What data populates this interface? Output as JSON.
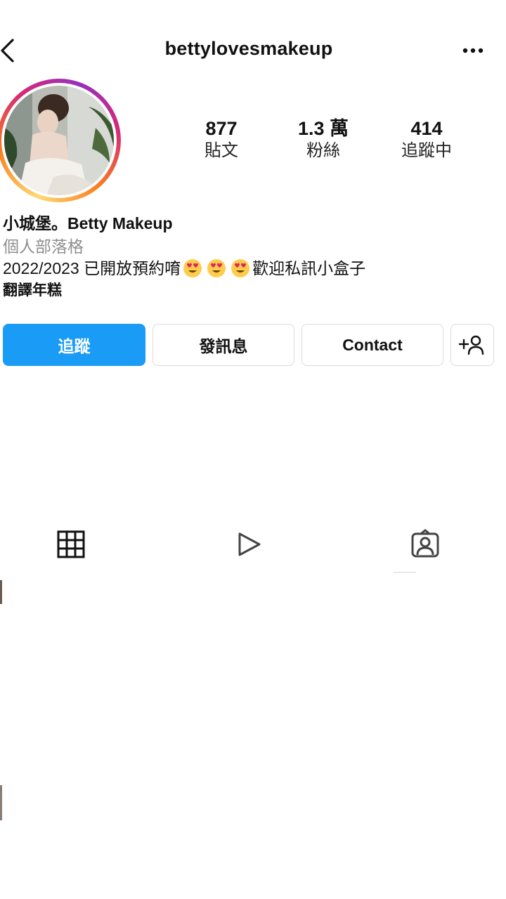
{
  "header": {
    "username": "bettylovesmakeup",
    "back_icon": "chevron-left-icon",
    "more_icon": "more-horizontal-icon"
  },
  "profile": {
    "avatar": "profile-photo",
    "stats": [
      {
        "value": "877",
        "label": "貼文"
      },
      {
        "value": "1.3 萬",
        "label": "粉絲"
      },
      {
        "value": "414",
        "label": "追蹤中"
      }
    ]
  },
  "bio": {
    "name": "小城堡。Betty Makeup",
    "category": "個人部落格",
    "text_before": "2022/2023 已開放預約唷",
    "text_after": "歡迎私訊小盒子",
    "emoji": "heart-eyes-emoji",
    "translate": "翻譯年糕"
  },
  "actions": {
    "follow": "追蹤",
    "message": "發訊息",
    "contact": "Contact",
    "add_user_icon": "add-user-icon"
  },
  "tabs": [
    {
      "icon": "grid-icon"
    },
    {
      "icon": "reels-play-icon"
    },
    {
      "icon": "tagged-person-icon"
    }
  ],
  "colors": {
    "follow_button": "#1a9bf5",
    "secondary_text": "#8e8e8e",
    "border": "#dbdbdb"
  }
}
